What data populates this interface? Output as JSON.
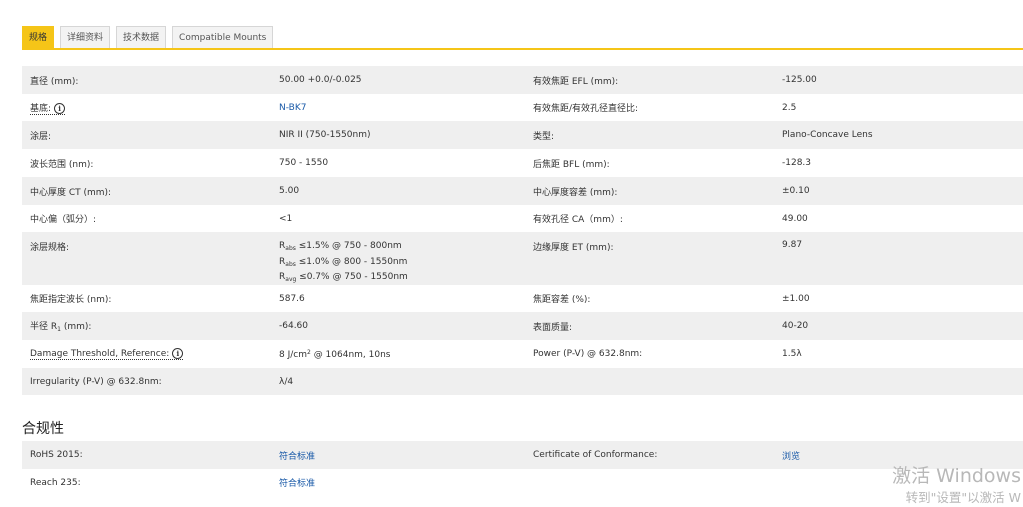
{
  "tabs": [
    {
      "label": "规格",
      "active": true
    },
    {
      "label": "详细资料",
      "active": false
    },
    {
      "label": "技术数据",
      "active": false
    },
    {
      "label": "Compatible Mounts",
      "active": false
    }
  ],
  "specs": {
    "diameter": {
      "label": "直径 (mm):",
      "value": "50.00 +0.0/-0.025"
    },
    "efl": {
      "label": "有效焦距 EFL (mm):",
      "value": "-125.00"
    },
    "substrate": {
      "label": "基底:",
      "value": "N-BK7"
    },
    "f_number": {
      "label": "有效焦距/有效孔径直径比:",
      "value": "2.5"
    },
    "coating": {
      "label": "涂层:",
      "value": "NIR II (750-1550nm)"
    },
    "type": {
      "label": "类型:",
      "value": "Plano-Concave Lens"
    },
    "wavelength_range": {
      "label": "波长范围 (nm):",
      "value": "750 - 1550"
    },
    "bfl": {
      "label": "后焦距 BFL (mm):",
      "value": "-128.3"
    },
    "ct": {
      "label": "中心厚度 CT (mm):",
      "value": "5.00"
    },
    "ct_tol": {
      "label": "中心厚度容差 (mm):",
      "value": "±0.10"
    },
    "centering": {
      "label": "中心偏（弧分）:",
      "value": "<1"
    },
    "ca": {
      "label": "有效孔径 CA（mm）:",
      "value": "49.00"
    },
    "coating_spec": {
      "label": "涂层规格:",
      "lines": [
        {
          "r": "R",
          "sub": "abs",
          "text": " ≤1.5% @ 750 - 800nm"
        },
        {
          "r": "R",
          "sub": "abs",
          "text": " ≤1.0% @ 800 - 1550nm"
        },
        {
          "r": "R",
          "sub": "avg",
          "text": " ≤0.7% @ 750 - 1550nm"
        }
      ]
    },
    "et": {
      "label": "边缘厚度 ET (mm):",
      "value": "9.87"
    },
    "design_wl": {
      "label": "焦距指定波长 (nm):",
      "value": "587.6"
    },
    "fl_tol": {
      "label": "焦距容差 (%):",
      "value": "±1.00"
    },
    "radius": {
      "label_pre": "半径 R",
      "label_sub": "1",
      "label_post": " (mm):",
      "value": "-64.60"
    },
    "surface_quality": {
      "label": "表面质量:",
      "value": "40-20"
    },
    "damage": {
      "label": "Damage Threshold, Reference:",
      "value_pre": "8 J/cm",
      "value_sup": "2",
      "value_post": " @ 1064nm, 10ns"
    },
    "power": {
      "label": "Power (P-V) @ 632.8nm:",
      "value": "1.5λ"
    },
    "irregularity": {
      "label": "Irregularity (P-V) @ 632.8nm:",
      "value": "λ/4"
    }
  },
  "compliance": {
    "title": "合规性",
    "rohs": {
      "label": "RoHS 2015:",
      "value": "符合标准"
    },
    "certificate": {
      "label": "Certificate of Conformance:",
      "value": "浏览"
    },
    "reach": {
      "label": "Reach 235:",
      "value": "符合标准"
    }
  },
  "watermark": {
    "line1": "激活 Windows",
    "line2": "转到\"设置\"以激活 W"
  },
  "colors": {
    "accent": "#f5c518",
    "link": "#1a5aa8",
    "row_shade": "#efefef"
  },
  "icons": {
    "info": "info-icon"
  }
}
